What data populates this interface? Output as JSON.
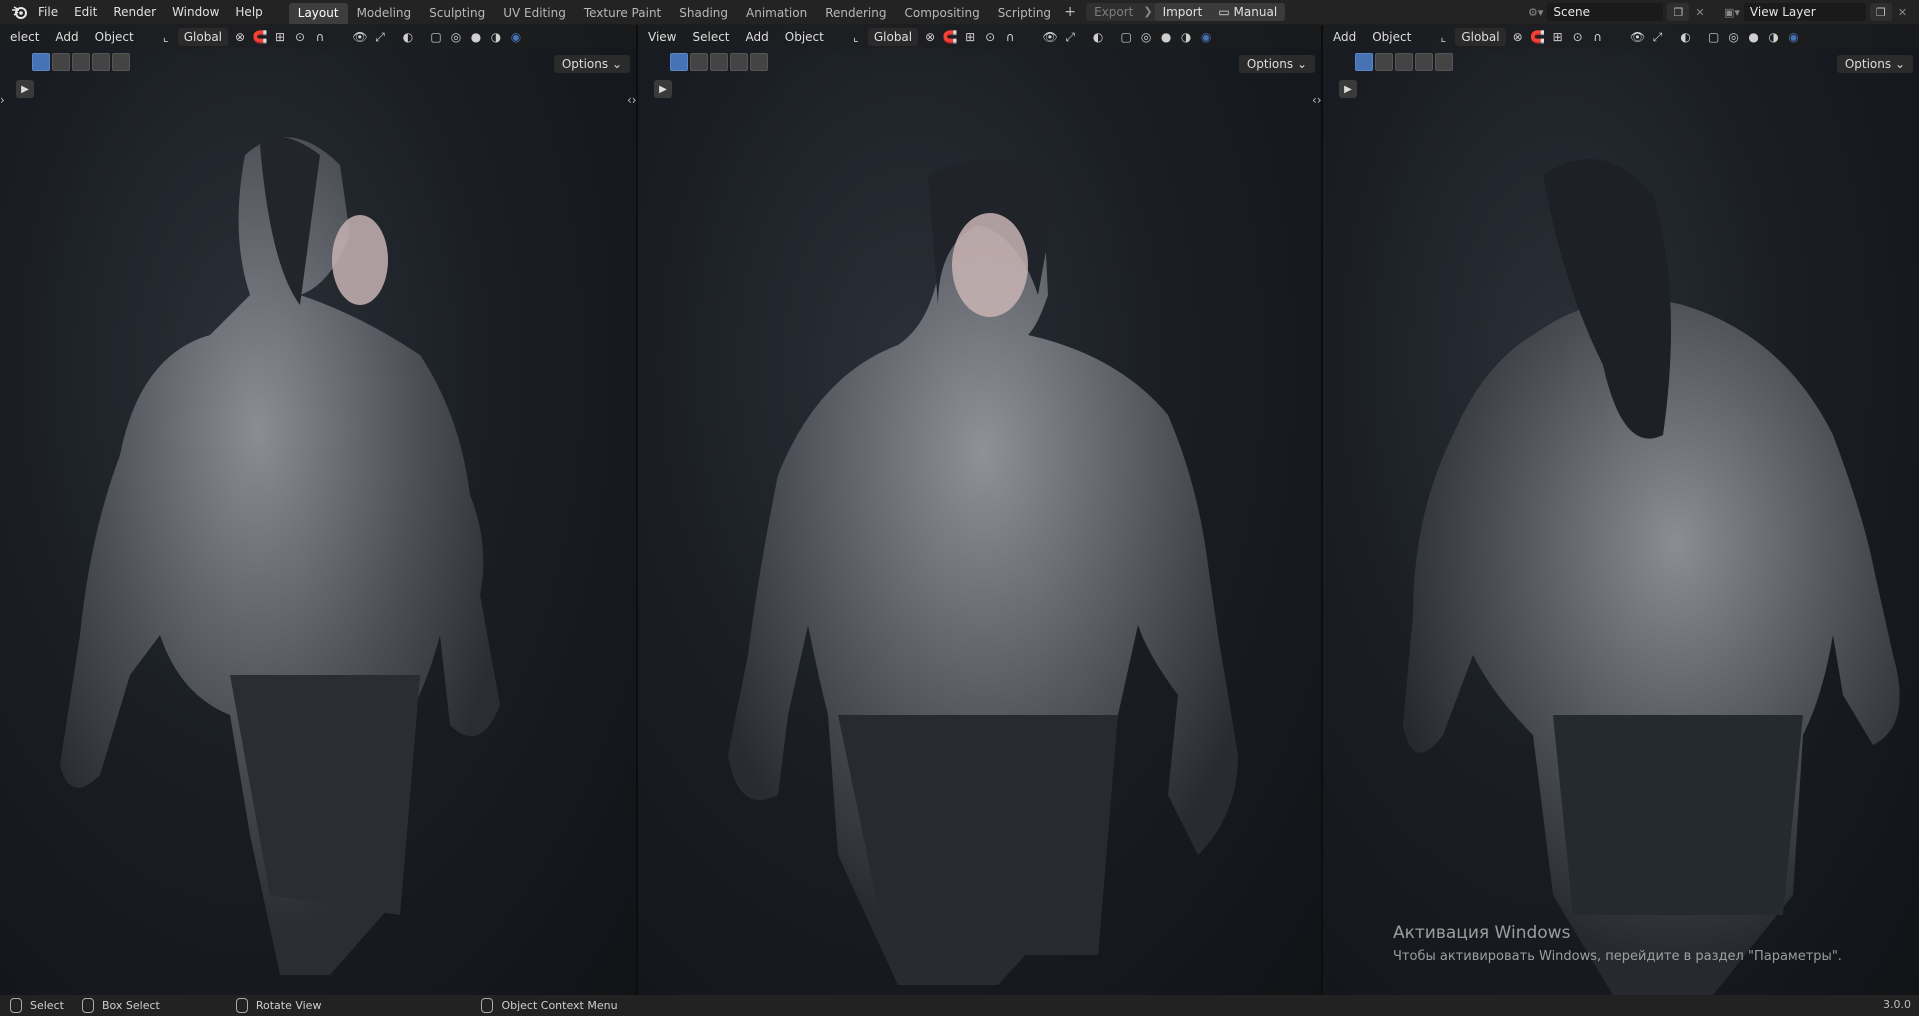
{
  "menu": [
    "File",
    "Edit",
    "Render",
    "Window",
    "Help"
  ],
  "workspaces": [
    "Layout",
    "Modeling",
    "Sculpting",
    "UV Editing",
    "Texture Paint",
    "Shading",
    "Animation",
    "Rendering",
    "Compositing",
    "Scripting"
  ],
  "active_workspace": "Layout",
  "addon_buttons": {
    "export": "Export",
    "import": "Import",
    "manual": "Manual"
  },
  "scene": {
    "name": "Scene",
    "view_layer": "View Layer"
  },
  "viewports": [
    {
      "menus": [
        "elect",
        "Add",
        "Object"
      ],
      "orientation": "Global",
      "options": "Options"
    },
    {
      "menus": [
        "View",
        "Select",
        "Add",
        "Object"
      ],
      "orientation": "Global",
      "options": "Options"
    },
    {
      "menus": [
        "Add",
        "Object"
      ],
      "orientation": "Global",
      "options": "Options"
    }
  ],
  "status": {
    "select": "Select",
    "box_select": "Box Select",
    "rotate_view": "Rotate View",
    "context_menu": "Object Context Menu",
    "version": "3.0.0"
  },
  "watermark": {
    "title": "Активация Windows",
    "subtitle": "Чтобы активировать Windows, перейдите в раздел \"Параметры\"."
  },
  "colors": {
    "accent": "#4772b3",
    "header_bg": "#232323",
    "viewport_bg": "#161a20"
  }
}
